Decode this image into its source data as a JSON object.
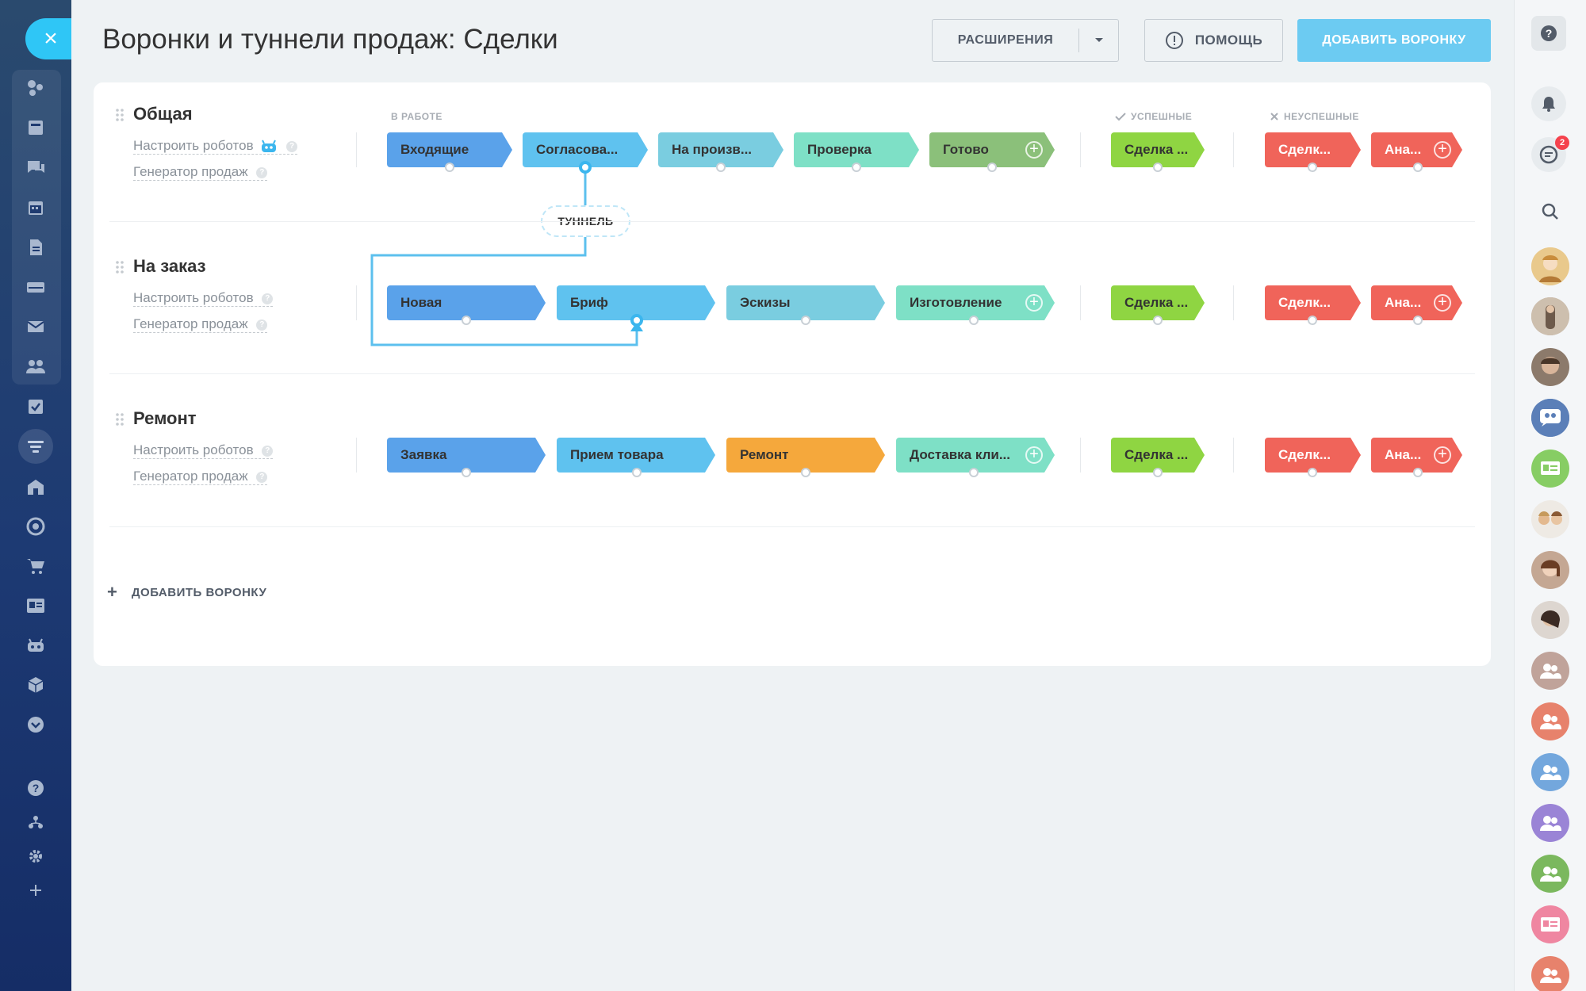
{
  "header": {
    "title": "Воронки и туннели продаж: Сделки",
    "extensions_label": "РАСШИРЕНИЯ",
    "help_label": "ПОМОЩЬ",
    "add_funnel_label": "ДОБАВИТЬ ВОРОНКУ"
  },
  "columns": {
    "in_work": "В РАБОТЕ",
    "success": "УСПЕШНЫЕ",
    "fail": "НЕУСПЕШНЫЕ"
  },
  "tunnel_label": "ТУННЕЛЬ",
  "funnels": [
    {
      "name": "Общая",
      "robots_link": "Настроить роботов",
      "generator_link": "Генератор продаж",
      "stages": [
        {
          "label": "Входящие",
          "color": "#5aa2ea"
        },
        {
          "label": "Согласова...",
          "color": "#5fc2ef"
        },
        {
          "label": "На произв...",
          "color": "#7acde0"
        },
        {
          "label": "Проверка",
          "color": "#7ee0c6"
        },
        {
          "label": "Готово",
          "color": "#8bc07a"
        }
      ],
      "success": {
        "label": "Сделка ...",
        "color": "#8fd542"
      },
      "fails": [
        {
          "label": "Сделк...",
          "color": "#f0645a"
        },
        {
          "label": "Ана...",
          "color": "#f0645a"
        }
      ]
    },
    {
      "name": "На заказ",
      "robots_link": "Настроить роботов",
      "generator_link": "Генератор продаж",
      "stages": [
        {
          "label": "Новая",
          "color": "#5aa2ea"
        },
        {
          "label": "Бриф",
          "color": "#5fc2ef"
        },
        {
          "label": "Эскизы",
          "color": "#7acde0"
        },
        {
          "label": "Изготовление",
          "color": "#7ee0c6"
        }
      ],
      "success": {
        "label": "Сделка ...",
        "color": "#8fd542"
      },
      "fails": [
        {
          "label": "Сделк...",
          "color": "#f0645a"
        },
        {
          "label": "Ана...",
          "color": "#f0645a"
        }
      ]
    },
    {
      "name": "Ремонт",
      "robots_link": "Настроить роботов",
      "generator_link": "Генератор продаж",
      "stages": [
        {
          "label": "Заявка",
          "color": "#5aa2ea"
        },
        {
          "label": "Прием товара",
          "color": "#5fc2ef"
        },
        {
          "label": "Ремонт",
          "color": "#f5a83c"
        },
        {
          "label": "Доставка кли...",
          "color": "#7ee0c6"
        }
      ],
      "success": {
        "label": "Сделка ...",
        "color": "#8fd542"
      },
      "fails": [
        {
          "label": "Сделк...",
          "color": "#f0645a"
        },
        {
          "label": "Ана...",
          "color": "#f0645a"
        }
      ]
    }
  ],
  "add_funnel_bottom": "ДОБАВИТЬ ВОРОНКУ",
  "right_sidebar": {
    "notification_badge": "2"
  }
}
